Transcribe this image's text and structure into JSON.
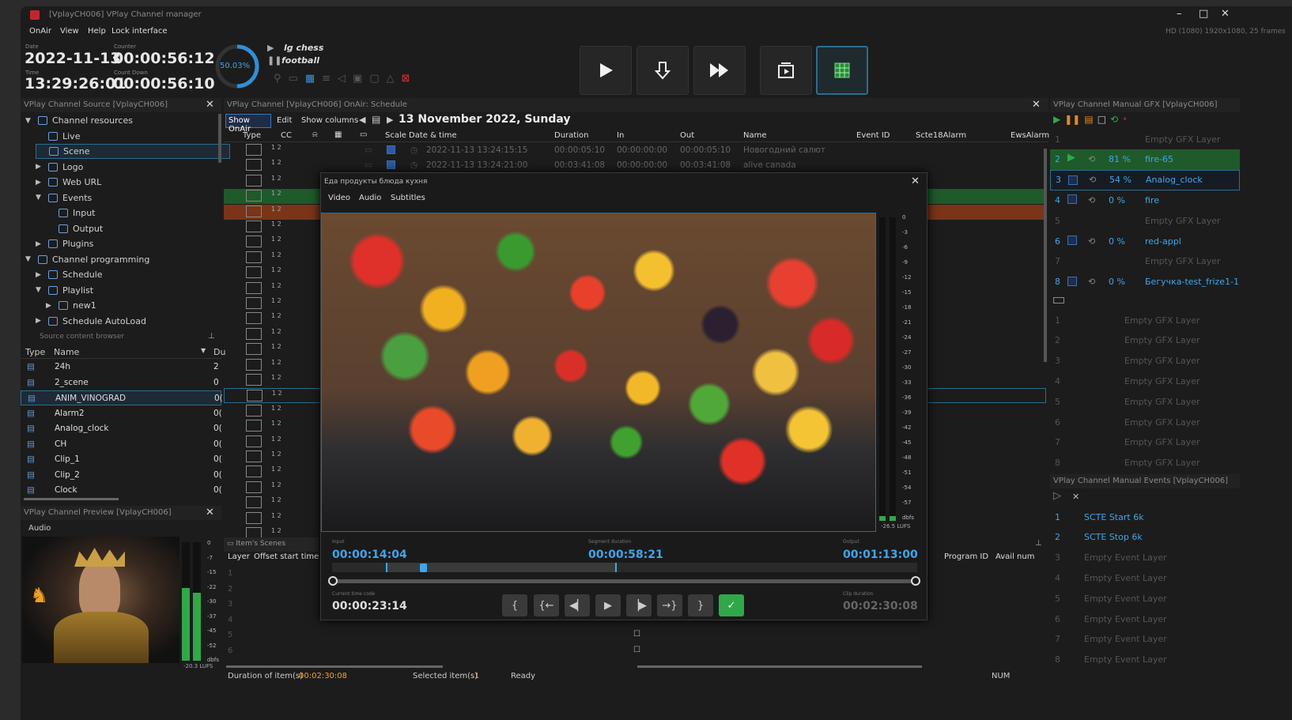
{
  "window": {
    "title": "[VplayCH006] VPlay Channel manager",
    "hd_info": "HD (1080) 1920x1080, 25 frames"
  },
  "menu": [
    "OnAir",
    "View",
    "Help",
    "Lock interface"
  ],
  "header": {
    "date_label": "Date",
    "date": "2022-11-13",
    "time_label": "Time",
    "time": "13:29:26:01",
    "counter_label": "Counter",
    "counter": "00:00:56:12",
    "countdown_label": "Count Down",
    "countdown": "00:00:56:10",
    "progress_text": "50.03%",
    "progress": 0.5003,
    "playing": "lg chess",
    "paused": "football"
  },
  "source_panel": {
    "title": "VPlay Channel Source [VplayCH006]",
    "tree": [
      {
        "label": "Channel resources",
        "indent": 0,
        "arrow": "▼"
      },
      {
        "label": "Live",
        "indent": 1,
        "arrow": ""
      },
      {
        "label": "Scene",
        "indent": 1,
        "arrow": ""
      },
      {
        "label": "Logo",
        "indent": 1,
        "arrow": "▶"
      },
      {
        "label": "Web URL",
        "indent": 1,
        "arrow": "▶"
      },
      {
        "label": "Events",
        "indent": 1,
        "arrow": "▼"
      },
      {
        "label": "Input",
        "indent": 2,
        "arrow": ""
      },
      {
        "label": "Output",
        "indent": 2,
        "arrow": ""
      },
      {
        "label": "Plugins",
        "indent": 1,
        "arrow": "▶"
      },
      {
        "label": "Channel programming",
        "indent": 0,
        "arrow": "▼"
      },
      {
        "label": "Schedule",
        "indent": 1,
        "arrow": "▶"
      },
      {
        "label": "Playlist",
        "indent": 1,
        "arrow": "▼"
      },
      {
        "label": "new1",
        "indent": 2,
        "arrow": "▶"
      },
      {
        "label": "Schedule AutoLoad",
        "indent": 1,
        "arrow": "▶"
      }
    ],
    "browser_title": "Source content browser",
    "col_type": "Type",
    "col_name": "Name",
    "col_d": "Du",
    "files": [
      {
        "name": "24h",
        "d": "2"
      },
      {
        "name": "2_scene",
        "d": "0"
      },
      {
        "name": "ANIM_VINOGRAD",
        "d": "0("
      },
      {
        "name": "Alarm2",
        "d": "0("
      },
      {
        "name": "Analog_clock",
        "d": "0("
      },
      {
        "name": "CH",
        "d": "0("
      },
      {
        "name": "Clip_1",
        "d": "0("
      },
      {
        "name": "Clip_2",
        "d": "0("
      },
      {
        "name": "Clock",
        "d": "0("
      }
    ]
  },
  "preview_panel": {
    "title": "VPlay Channel Preview [VplayCH006]",
    "tab": "Audio",
    "scale": [
      "0",
      "-7",
      "-15",
      "-22",
      "-30",
      "-37",
      "-45",
      "-52",
      "dbfs"
    ],
    "lufs": "-20.3 LUFS"
  },
  "schedule": {
    "title": "VPlay Channel [VplayCH006] OnAir: Schedule",
    "tabs": [
      "Show OnAir",
      "Edit",
      "Show columns"
    ],
    "date": "13 November 2022, Sunday",
    "columns": [
      "Type",
      "CC",
      "Scale",
      "Date & time",
      "Duration",
      "In",
      "Out",
      "Name",
      "Event ID",
      "Scte18Alarm",
      "EwsAlarm"
    ],
    "rows": [
      {
        "dt": "2022-11-13 13:24:15:15",
        "dur": "00:00:05:10",
        "in": "00:00:00:00",
        "out": "00:00:05:10",
        "name": "Новогодний салют"
      },
      {
        "dt": "2022-11-13 13:24:21:00",
        "dur": "00:03:41:08",
        "in": "00:00:00:00",
        "out": "00:03:41:08",
        "name": "alive  canada"
      }
    ],
    "cc": "1 2",
    "scenes_title": "Item's Scenes",
    "scenes_cols": [
      "Layer",
      "Offset start time"
    ],
    "right_cols": [
      "Program ID",
      "Avail num"
    ],
    "status": {
      "duration_label": "Duration of item(s)",
      "duration": "00:02:30:08",
      "selected_label": "Selected item(s)",
      "selected": "1",
      "ready": "Ready",
      "num": "NUM"
    }
  },
  "clip_dialog": {
    "title": "Еда продукты блюда кухня",
    "tabs": [
      "Video",
      "Audio",
      "Subtitles"
    ],
    "input_label": "Input",
    "input": "00:00:14:04",
    "seg_label": "Segment duration",
    "seg": "00:00:58:21",
    "output_label": "Output",
    "output": "00:01:13:00",
    "tc_label": "Current time code",
    "tc": "00:00:23:14",
    "clipdur_label": "Clip duration",
    "clipdur": "00:02:30:08",
    "scale": [
      "0",
      "-3",
      "-6",
      "-9",
      "-12",
      "-15",
      "-18",
      "-21",
      "-24",
      "-27",
      "-30",
      "-33",
      "-36",
      "-39",
      "-42",
      "-45",
      "-48",
      "-51",
      "-54",
      "-57",
      "dbfs"
    ],
    "lufs": "-26.5 LUFS"
  },
  "gfx": {
    "title": "VPlay Channel Manual GFX [VplayCH006]",
    "rows": [
      {
        "n": "1",
        "pct": "",
        "name": "Empty GFX Layer",
        "empty": true
      },
      {
        "n": "2",
        "pct": "81 %",
        "name": "fire-65",
        "empty": false,
        "active": true
      },
      {
        "n": "3",
        "pct": "54 %",
        "name": "Analog_clock",
        "empty": false,
        "sel": true
      },
      {
        "n": "4",
        "pct": "0 %",
        "name": "fire",
        "empty": false
      },
      {
        "n": "5",
        "pct": "",
        "name": "Empty GFX Layer",
        "empty": true
      },
      {
        "n": "6",
        "pct": "0 %",
        "name": "red-appl",
        "empty": false
      },
      {
        "n": "7",
        "pct": "",
        "name": "Empty GFX Layer",
        "empty": true
      },
      {
        "n": "8",
        "pct": "0 %",
        "name": "Бегучка-test_frize1-1",
        "empty": false
      }
    ],
    "rows2": [
      {
        "n": "1",
        "name": "Empty GFX Layer"
      },
      {
        "n": "2",
        "name": "Empty GFX Layer"
      },
      {
        "n": "3",
        "name": "Empty GFX Layer"
      },
      {
        "n": "4",
        "name": "Empty GFX Layer"
      },
      {
        "n": "5",
        "name": "Empty GFX Layer"
      },
      {
        "n": "6",
        "name": "Empty GFX Layer"
      },
      {
        "n": "7",
        "name": "Empty GFX Layer"
      },
      {
        "n": "8",
        "name": "Empty GFX Layer"
      }
    ]
  },
  "events": {
    "title": "VPlay Channel Manual Events [VplayCH006]",
    "rows": [
      {
        "n": "1",
        "name": "SCTE Start 6k",
        "empty": false
      },
      {
        "n": "2",
        "name": "SCTE Stop 6k",
        "empty": false
      },
      {
        "n": "3",
        "name": "Empty Event Layer",
        "empty": true
      },
      {
        "n": "4",
        "name": "Empty Event Layer",
        "empty": true
      },
      {
        "n": "5",
        "name": "Empty Event Layer",
        "empty": true
      },
      {
        "n": "6",
        "name": "Empty Event Layer",
        "empty": true
      },
      {
        "n": "7",
        "name": "Empty Event Layer",
        "empty": true
      },
      {
        "n": "8",
        "name": "Empty Event Layer",
        "empty": true
      }
    ]
  }
}
